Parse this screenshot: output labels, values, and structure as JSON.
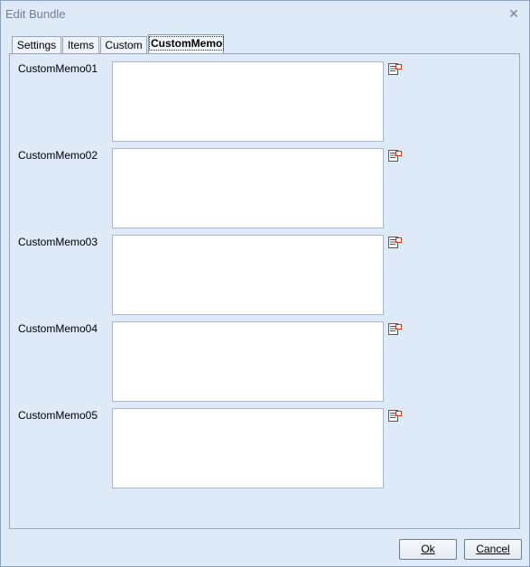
{
  "window": {
    "title": "Edit Bundle",
    "close_glyph": "✕"
  },
  "tabs": [
    {
      "label": "Settings"
    },
    {
      "label": "Items"
    },
    {
      "label": "Custom"
    },
    {
      "label": "CustomMemo",
      "active": true
    }
  ],
  "memos": [
    {
      "label": "CustomMemo01",
      "value": "",
      "icon": "memo-edit-icon"
    },
    {
      "label": "CustomMemo02",
      "value": "",
      "icon": "memo-edit-icon"
    },
    {
      "label": "CustomMemo03",
      "value": "",
      "icon": "memo-edit-icon"
    },
    {
      "label": "CustomMemo04",
      "value": "",
      "icon": "memo-edit-icon"
    },
    {
      "label": "CustomMemo05",
      "value": "",
      "icon": "memo-edit-icon"
    }
  ],
  "buttons": {
    "ok": "Ok",
    "cancel": "Cancel"
  },
  "colors": {
    "accent": "#dfeaf9",
    "icon_red": "#c0392b"
  }
}
